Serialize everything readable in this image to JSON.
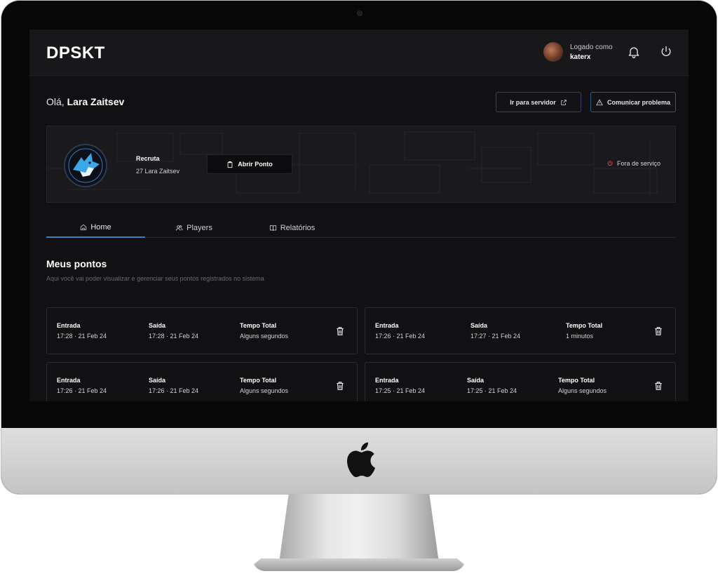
{
  "app": {
    "brand": "DPSKT",
    "logged_label": "Logado como",
    "logged_user": "katerx"
  },
  "header": {
    "greeting_prefix": "Olá,",
    "greeting_name": "Lara Zaitsev",
    "server_button": "Ir para servidor",
    "report_button": "Comunicar problema"
  },
  "profile": {
    "rank": "Recruta",
    "name": "27 Lara Zaitsev",
    "open_button": "Abrir Ponto",
    "status": "Fora de serviço",
    "status_color": "#e5484d"
  },
  "tabs": [
    {
      "label": "Home",
      "icon": "home-icon"
    },
    {
      "label": "Players",
      "icon": "users-icon"
    },
    {
      "label": "Relatórios",
      "icon": "book-icon"
    }
  ],
  "section": {
    "title": "Meus pontos",
    "subtitle": "Aqui você vai poder visualizar e gerenciar seus pontos registrados no sistema"
  },
  "labels": {
    "entrada": "Entrada",
    "saida": "Saída",
    "total": "Tempo Total"
  },
  "records": [
    {
      "entrada": "17:28 · 21 Feb 24",
      "saida": "17:28 · 21 Feb 24",
      "total": "Alguns segundos"
    },
    {
      "entrada": "17:26 · 21 Feb 24",
      "saida": "17:27 · 21 Feb 24",
      "total": "1 minutos"
    },
    {
      "entrada": "17:26 · 21 Feb 24",
      "saida": "17:26 · 21 Feb 24",
      "total": "Alguns segundos"
    },
    {
      "entrada": "17:25 · 21 Feb 24",
      "saida": "17:25 · 21 Feb 24",
      "total": "Alguns segundos"
    }
  ],
  "colors": {
    "accent_tab": "#3f7fbf",
    "server_border": "#3a3d70",
    "report_border": "#2f5b86"
  }
}
